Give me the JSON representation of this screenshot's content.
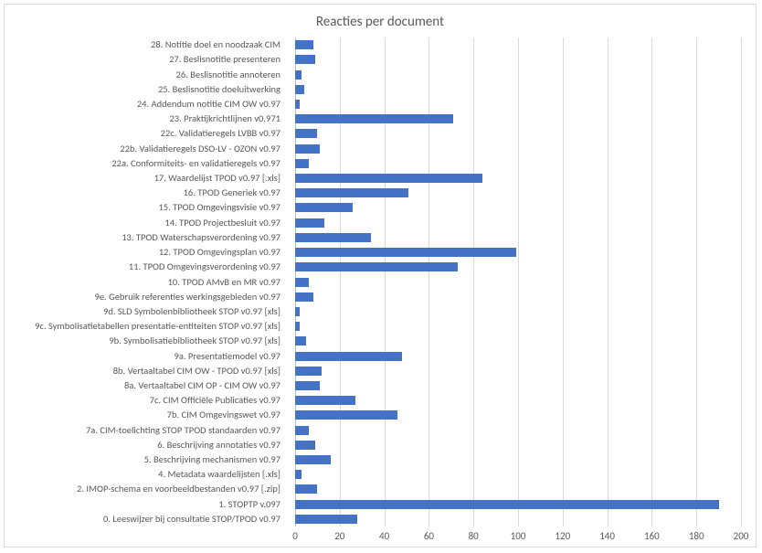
{
  "chart_data": {
    "type": "bar",
    "orientation": "horizontal",
    "title": "Reacties per document",
    "xlabel": "",
    "ylabel": "",
    "xlim": [
      0,
      200
    ],
    "xticks": [
      0,
      20,
      40,
      60,
      80,
      100,
      120,
      140,
      160,
      180,
      200
    ],
    "categories": [
      "0. Leeswijzer bij consultatie STOP/TPOD v0.97",
      "1. STOPTP v.097",
      "2. IMOP-schema en voorbeeldbestanden v0.97 [.zip]",
      "4. Metadata waardelijsten [.xls]",
      "5. Beschrijving mechanismen v0.97",
      "6. Beschrijving annotaties v0.97",
      "7a. CIM-toelichting STOP TPOD standaarden v0.97",
      "7b. CIM Omgevingswet v0.97",
      "7c. CIM Officiële Publicaties v0.97",
      "8a. Vertaaltabel CIM OP - CIM OW v0.97",
      "8b. Vertaaltabel CIM OW - TPOD v0.97 [xls]",
      "9a. Presentatiemodel v0.97",
      "9b. Symbolisatiebibliotheek STOP v0.97 [xls]",
      "9c. Symbolisatietabellen presentatie-entiteiten STOP v0.97 [xls]",
      "9d. SLD Symbolenbibliotheek STOP v0.97 [xls]",
      "9e. Gebruik referenties werkingsgebieden v0.97",
      "10. TPOD AMvB en MR v0.97",
      "11. TPOD Omgevingsverordening v0.97",
      "12. TPOD Omgevingsplan v0.97",
      "13. TPOD Waterschapsverordening v0.97",
      "14. TPOD Projectbesluit v0.97",
      "15. TPOD Omgevingsvisie v0.97",
      "16. TPOD Generiek v0.97",
      "17. Waardelijst TPOD v0.97 [.xls]",
      "22a. Conformiteits- en validatieregels v0.97",
      "22b. Validatieregels DSO-LV - OZON v0.97",
      "22c. Validatieregels LVBB v0.97",
      "23. Praktijkrichtlijnen v0.971",
      "24. Addendum notitie CIM OW v0.97",
      "25. Beslisnotitie doeluitwerking",
      "26. Beslisnotitie annoteren",
      "27. Beslisnotitie presenteren",
      "28. Notitie doel en noodzaak CIM"
    ],
    "values": [
      28,
      190,
      10,
      3,
      16,
      9,
      6,
      46,
      27,
      11,
      12,
      48,
      5,
      2,
      2,
      8,
      6,
      73,
      99,
      34,
      13,
      26,
      51,
      84,
      6,
      11,
      10,
      71,
      2,
      4,
      3,
      9,
      8
    ],
    "bar_color": "#4472C4"
  }
}
